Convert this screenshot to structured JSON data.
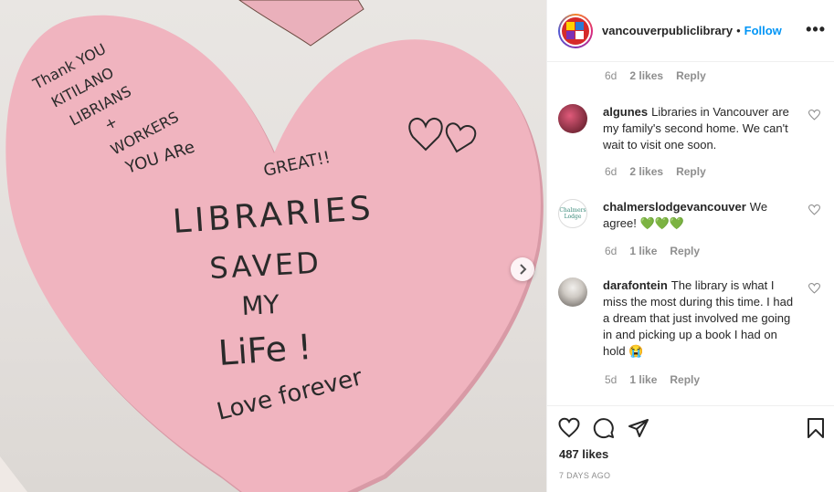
{
  "photo": {
    "note_lines": {
      "thank1": "Thank YOU",
      "thank2": "KITILANO",
      "thank3": "LIBRIANS",
      "thank4": "+",
      "thank5": "WORKERS",
      "great1": "YOU ARe",
      "great2": "GREAT!!",
      "big1": "LIBRARIES",
      "big2": "SAVED",
      "big3": "MY",
      "big4": "LiFe !",
      "sign": "Love forever"
    },
    "next_icon": "chevron-right-icon"
  },
  "header": {
    "username": "vancouverpubliclibrary",
    "separator": "•",
    "follow_label": "Follow",
    "more_label": "•••"
  },
  "top_meta": {
    "time": "6d",
    "likes": "2 likes",
    "reply": "Reply"
  },
  "comments": [
    {
      "user": "algunes",
      "text": "Libraries in Vancouver are my family's second home. We can't wait to visit one soon.",
      "time": "6d",
      "likes": "2 likes",
      "reply": "Reply"
    },
    {
      "user": "chalmerslodgevancouver",
      "text": "We agree! 💚💚💚",
      "avatar_text": "Chalmers Lodge",
      "time": "6d",
      "likes": "1 like",
      "reply": "Reply"
    },
    {
      "user": "darafontein",
      "text": "The library is what I miss the most during this time. I had a dream that just involved me going in and picking up a book I had on hold 😭",
      "time": "5d",
      "likes": "1 like",
      "reply": "Reply"
    }
  ],
  "actions": {
    "likes_count": "487 likes",
    "time_ago": "7 DAYS AGO"
  },
  "colors": {
    "accent": "#0095f6",
    "heart_paper": "#f0b4bf",
    "wall": "#e6e2df"
  }
}
